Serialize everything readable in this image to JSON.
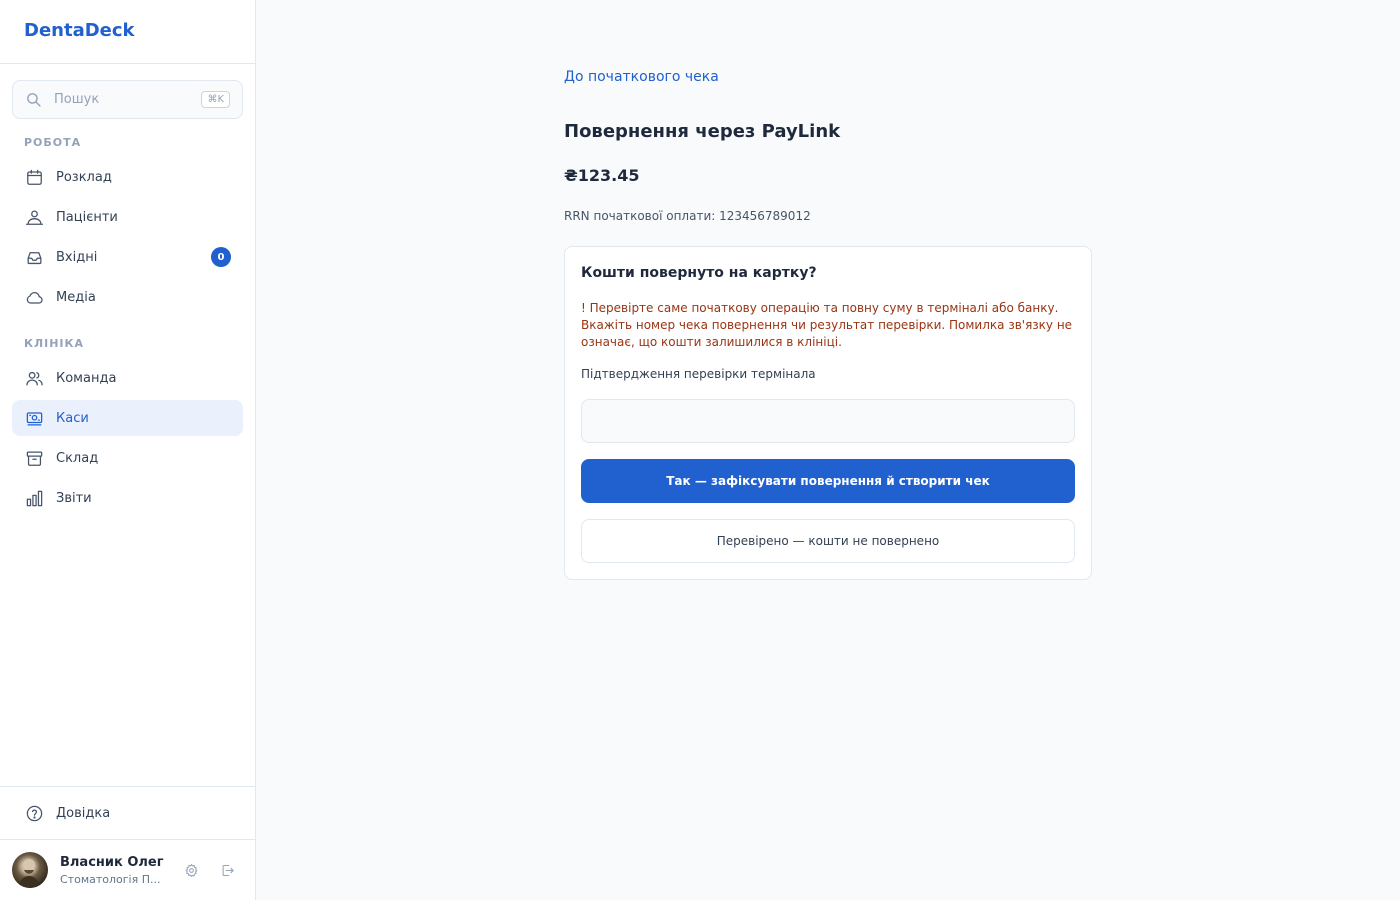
{
  "app": {
    "brand": "DentaDeck"
  },
  "search": {
    "placeholder": "Пошук",
    "shortcut": "⌘K"
  },
  "sidebar": {
    "sections": [
      {
        "label": "РОБОТА"
      },
      {
        "label": "КЛІНІКА"
      }
    ],
    "items": [
      {
        "label": "Розклад",
        "icon": "calendar-icon"
      },
      {
        "label": "Пацієнти",
        "icon": "patients-icon"
      },
      {
        "label": "Вхідні",
        "icon": "inbox-icon",
        "badge": "0"
      },
      {
        "label": "Медіа",
        "icon": "cloud-icon"
      },
      {
        "label": "Команда",
        "icon": "team-icon"
      },
      {
        "label": "Каси",
        "icon": "cash-register-icon",
        "active": true
      },
      {
        "label": "Склад",
        "icon": "archive-icon"
      },
      {
        "label": "Звіти",
        "icon": "bar-chart-icon"
      }
    ],
    "help": {
      "label": "Довідка",
      "icon": "help-circle-icon"
    }
  },
  "user": {
    "name": "Власник Олег",
    "clinic": "Стоматологія П...",
    "settings_icon": "gear-icon",
    "logout_icon": "logout-icon"
  },
  "main": {
    "back_link": "До початкового чека",
    "title": "Повернення через PayLink",
    "amount": "₴123.45",
    "rrn": "RRN початкової оплати: 123456789012",
    "card": {
      "title": "Кошти повернуто на картку?",
      "warning": "! Перевірте саме початкову операцію та повну суму в терміналі або банку. Вкажіть номер чека повернення чи результат перевірки. Помилка зв'язку не означає, що кошти залишилися в клініці.",
      "field_label": "Підтвердження перевірки термінала",
      "field_value": "",
      "primary_button": "Так — зафіксувати повернення й створити чек",
      "secondary_button": "Перевірено — кошти не повернено"
    }
  },
  "colors": {
    "accent": "#2160cf",
    "active_bg": "#eaf1fd",
    "warning_text": "#9a3412",
    "page_bg": "#f8fafc"
  }
}
